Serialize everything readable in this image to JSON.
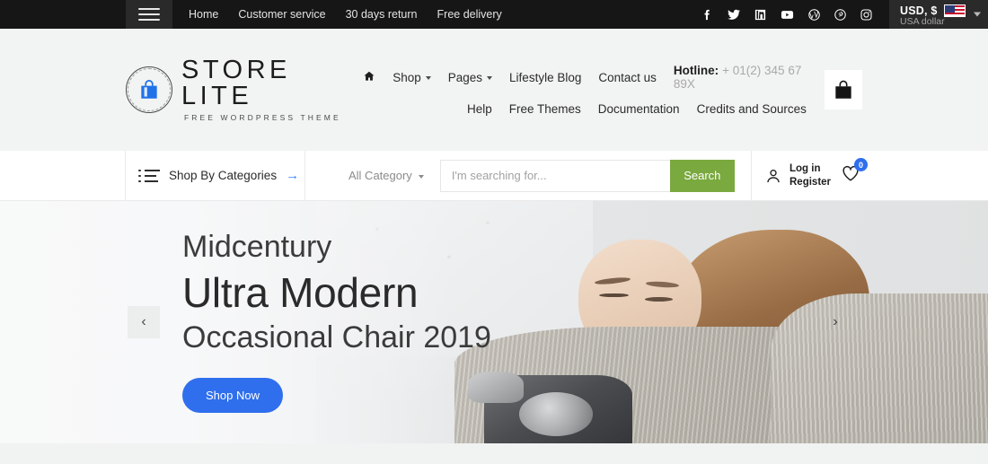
{
  "topbar": {
    "menu_icon": "hamburger-icon",
    "links": [
      "Home",
      "Customer service",
      "30 days return",
      "Free delivery"
    ],
    "socials": [
      {
        "name": "facebook-icon"
      },
      {
        "name": "twitter-icon"
      },
      {
        "name": "linkedin-icon"
      },
      {
        "name": "youtube-icon"
      },
      {
        "name": "wordpress-icon"
      },
      {
        "name": "pinterest-icon"
      },
      {
        "name": "instagram-icon"
      }
    ],
    "currency": {
      "code": "USD, $",
      "name": "USA dollar",
      "flag": "us-flag-icon",
      "caret": "chevron-down-icon"
    }
  },
  "header": {
    "logo": {
      "title": "STORE LITE",
      "subtitle": "FREE WORDPRESS THEME",
      "icon": "shopping-bag-icon",
      "icon_color": "#1f72e8"
    },
    "nav_row1": [
      {
        "label": "",
        "icon": "home-icon",
        "dropdown": false
      },
      {
        "label": "Shop",
        "dropdown": true
      },
      {
        "label": "Pages",
        "dropdown": true
      },
      {
        "label": "Lifestyle Blog",
        "dropdown": false
      },
      {
        "label": "Contact us",
        "dropdown": false
      }
    ],
    "hotline_label": "Hotline:",
    "hotline_number": "+ 01(2) 345 67 89X",
    "nav_row2": [
      "Help",
      "Free Themes",
      "Documentation",
      "Credits and Sources"
    ],
    "cart_icon": "shopping-bag-icon"
  },
  "searchrow": {
    "categories_label": "Shop By Categories",
    "categories_icon": "list-icon",
    "categories_arrow": "arrow-right-icon",
    "category_select": "All Category",
    "search_placeholder": "I'm searching for...",
    "search_value": "",
    "search_button": "Search",
    "account_icon": "user-icon",
    "account_line1": "Log in",
    "account_line2": "Register",
    "wishlist_icon": "heart-icon",
    "wishlist_count": "0",
    "badge_color": "#2f6fed",
    "search_button_color": "#7aa93f"
  },
  "hero": {
    "line1": "Midcentury",
    "line2": "Ultra Modern",
    "line3": "Occasional Chair 2019",
    "cta_label": "Shop Now",
    "cta_color": "#2f6fed",
    "prev_icon": "chevron-left-icon",
    "next_icon": "chevron-right-icon"
  }
}
